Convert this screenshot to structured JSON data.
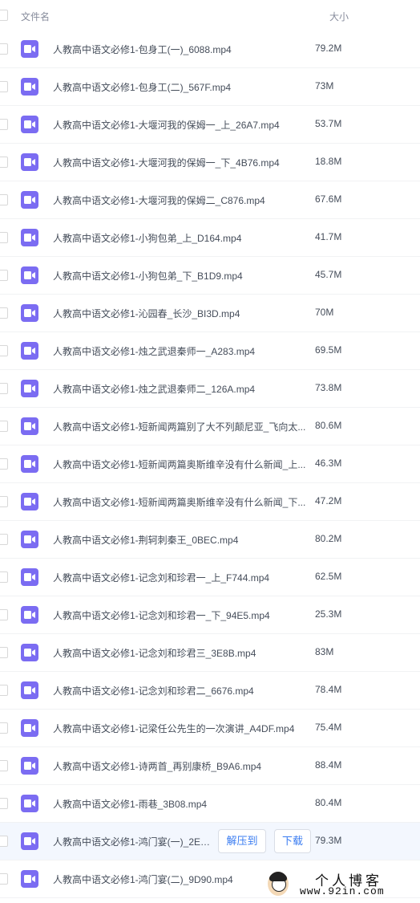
{
  "header": {
    "name_label": "文件名",
    "size_label": "大小"
  },
  "files": [
    {
      "name": "人教高中语文必修1-包身工(一)_6088.mp4",
      "size": "79.2M"
    },
    {
      "name": "人教高中语文必修1-包身工(二)_567F.mp4",
      "size": "73M"
    },
    {
      "name": "人教高中语文必修1-大堰河我的保姆一_上_26A7.mp4",
      "size": "53.7M"
    },
    {
      "name": "人教高中语文必修1-大堰河我的保姆一_下_4B76.mp4",
      "size": "18.8M"
    },
    {
      "name": "人教高中语文必修1-大堰河我的保姆二_C876.mp4",
      "size": "67.6M"
    },
    {
      "name": "人教高中语文必修1-小狗包弟_上_D164.mp4",
      "size": "41.7M"
    },
    {
      "name": "人教高中语文必修1-小狗包弟_下_B1D9.mp4",
      "size": "45.7M"
    },
    {
      "name": "人教高中语文必修1-沁园春_长沙_BI3D.mp4",
      "size": "70M"
    },
    {
      "name": "人教高中语文必修1-烛之武退秦师一_A283.mp4",
      "size": "69.5M"
    },
    {
      "name": "人教高中语文必修1-烛之武退秦师二_126A.mp4",
      "size": "73.8M"
    },
    {
      "name": "人教高中语文必修1-短新闻两篇别了大不列颠尼亚_飞向太...",
      "size": "80.6M"
    },
    {
      "name": "人教高中语文必修1-短新闻两篇奥斯维辛没有什么新闻_上...",
      "size": "46.3M"
    },
    {
      "name": "人教高中语文必修1-短新闻两篇奥斯维辛没有什么新闻_下...",
      "size": "47.2M"
    },
    {
      "name": "人教高中语文必修1-荆轲刺秦王_0BEC.mp4",
      "size": "80.2M"
    },
    {
      "name": "人教高中语文必修1-记念刘和珍君一_上_F744.mp4",
      "size": "62.5M"
    },
    {
      "name": "人教高中语文必修1-记念刘和珍君一_下_94E5.mp4",
      "size": "25.3M"
    },
    {
      "name": "人教高中语文必修1-记念刘和珍君三_3E8B.mp4",
      "size": "83M"
    },
    {
      "name": "人教高中语文必修1-记念刘和珍君二_6676.mp4",
      "size": "78.4M"
    },
    {
      "name": "人教高中语文必修1-记梁任公先生的一次演讲_A4DF.mp4",
      "size": "75.4M"
    },
    {
      "name": "人教高中语文必修1-诗两首_再别康桥_B9A6.mp4",
      "size": "88.4M"
    },
    {
      "name": "人教高中语文必修1-雨巷_3B08.mp4",
      "size": "80.4M"
    },
    {
      "name": "人教高中语文必修1-鸿门宴(一)_2E4...",
      "size": "79.3M",
      "hovered": true
    },
    {
      "name": "人教高中语文必修1-鸿门宴(二)_9D90.mp4",
      "size": ""
    }
  ],
  "row_actions": {
    "extract_label": "解压到",
    "download_label": "下载"
  },
  "watermark": {
    "title": "个人博客",
    "url": "www.92in.com"
  },
  "icons": {
    "file": "video-file-icon"
  },
  "colors": {
    "icon": "#7b6cf2",
    "action": "#3a7cf1",
    "hover_row": "#f3f7fe"
  }
}
